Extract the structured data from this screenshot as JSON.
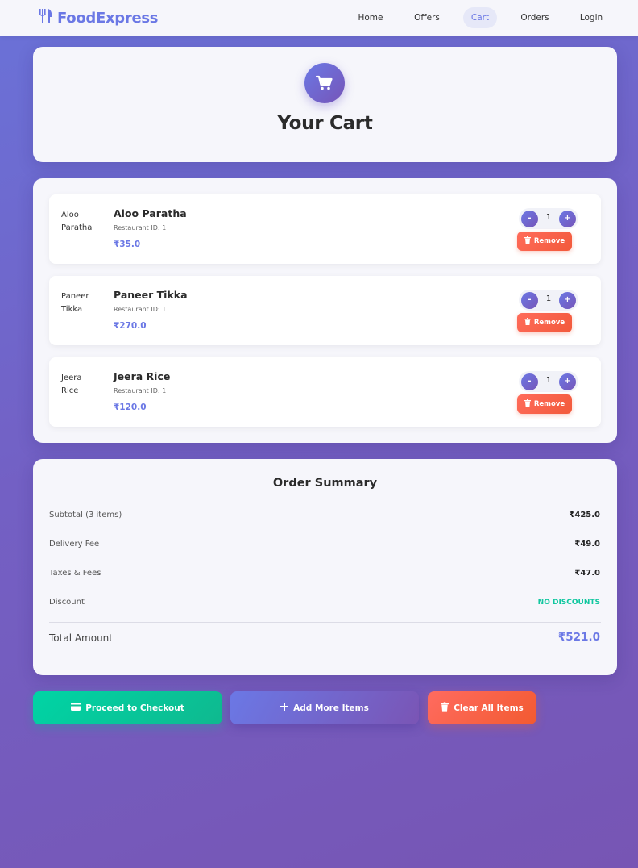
{
  "navbar": {
    "brand": "FoodExpress",
    "links": [
      {
        "label": "Home"
      },
      {
        "label": "Offers"
      },
      {
        "label": "Cart"
      },
      {
        "label": "Orders"
      },
      {
        "label": "Login"
      }
    ]
  },
  "header": {
    "title": "Your Cart"
  },
  "cart": {
    "items": [
      {
        "name": "Aloo Paratha",
        "image_alt": "Aloo Paratha",
        "restaurant": "Restaurant ID: 1",
        "price": "₹35.0",
        "quantity": "1",
        "minus": "-",
        "plus": "+",
        "remove_label": "Remove"
      },
      {
        "name": "Paneer Tikka",
        "image_alt": "Paneer Tikka",
        "restaurant": "Restaurant ID: 1",
        "price": "₹270.0",
        "quantity": "1",
        "minus": "-",
        "plus": "+",
        "remove_label": "Remove"
      },
      {
        "name": "Jeera Rice",
        "image_alt": "Jeera Rice",
        "restaurant": "Restaurant ID: 1",
        "price": "₹120.0",
        "quantity": "1",
        "minus": "-",
        "plus": "+",
        "remove_label": "Remove"
      }
    ]
  },
  "summary": {
    "title": "Order Summary",
    "rows": [
      {
        "label": "Subtotal (3 items)",
        "value": "₹425.0"
      },
      {
        "label": "Delivery Fee",
        "value": "₹49.0"
      },
      {
        "label": "Taxes & Fees",
        "value": "₹47.0"
      },
      {
        "label": "Discount",
        "value": "NO DISCOUNTS"
      }
    ],
    "total_label": "Total Amount",
    "total_value": "₹521.0"
  },
  "actions": {
    "checkout": "Proceed to Checkout",
    "add_more": "Add More Items",
    "clear_all": "Clear All Items"
  },
  "colors": {
    "accent": "#6b78e5",
    "checkout": "#00d4a5",
    "danger": "#f25a3b",
    "discount": "#12c7a0"
  },
  "icons": {
    "brand": "utensils-icon",
    "header": "shopping-cart-icon",
    "remove": "trash-icon",
    "checkout": "credit-card-icon",
    "add": "plus-icon",
    "clear": "trash-icon"
  }
}
